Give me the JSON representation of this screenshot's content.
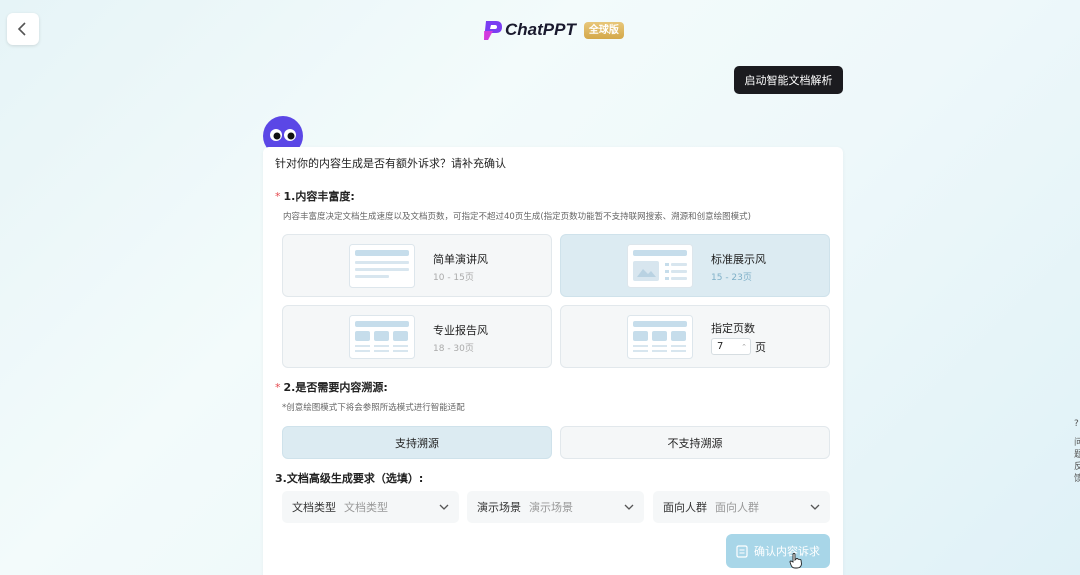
{
  "header": {
    "logo_text": "ChatPPT",
    "logo_badge": "全球版",
    "parse_button": "启动智能文档解析"
  },
  "card": {
    "question": "针对你的内容生成是否有额外诉求？请补充确认",
    "section1": {
      "title": "1.内容丰富度:",
      "desc": "内容丰富度决定文档生成速度以及文档页数，可指定不超过40页生成(指定页数功能暂不支持联网搜索、溯源和创意绘图模式)",
      "options": [
        {
          "name": "简单演讲风",
          "range": "10 - 15页",
          "selected": false
        },
        {
          "name": "标准展示风",
          "range": "15 - 23页",
          "selected": true
        },
        {
          "name": "专业报告风",
          "range": "18 - 30页",
          "selected": false
        }
      ],
      "custom": {
        "name": "指定页数",
        "value": "7",
        "unit": "页"
      }
    },
    "section2": {
      "title": "2.是否需要内容溯源:",
      "desc": "*创意绘图模式下将会参照所选模式进行智能适配",
      "support": "支持溯源",
      "no_support": "不支持溯源",
      "selected": "support"
    },
    "section3": {
      "title": "3.文档高级生成要求（选填）:",
      "selects": [
        {
          "label": "文档类型",
          "placeholder": "文档类型"
        },
        {
          "label": "演示场景",
          "placeholder": "演示场景"
        },
        {
          "label": "面向人群",
          "placeholder": "面向人群"
        }
      ]
    },
    "confirm_button": "确认内容诉求"
  },
  "colors": {
    "accent": "#a8d6e8",
    "selected_bg": "#dcebf2",
    "required_star": "#e5484d",
    "dark_button": "#1b1b1f",
    "badge_gold": "#d4a849"
  },
  "right_edge": {
    "glyphs": [
      "问",
      "题",
      "反",
      "馈"
    ]
  }
}
